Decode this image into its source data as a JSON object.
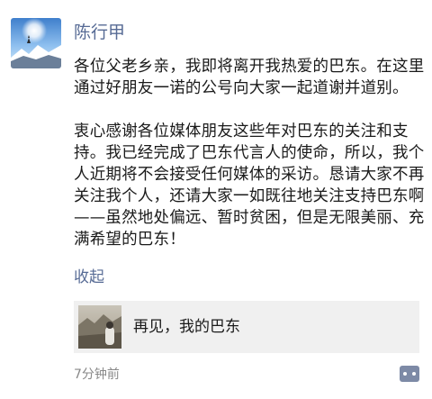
{
  "post": {
    "username": "陈行甲",
    "paragraphs": [
      "各位父老乡亲，我即将离开我热爱的巴东。在这里通过好朋友一诺的公号向大家一起道谢并道别。",
      "衷心感谢各位媒体朋友这些年对巴东的关注和支持。我已经完成了巴东代言人的使命，所以，我个人近期将不会接受任何媒体的采访。恳请大家不再关注我个人，还请大家一如既往地关注支持巴东啊——虽然地处偏远、暂时贫困，但是无限美丽、充满希望的巴东！"
    ],
    "collapse_label": "收起",
    "link_title": "再见，我的巴东",
    "time": "7分钟前"
  },
  "icons": {
    "comment": "comment-icon"
  },
  "colors": {
    "name_link": "#576b95",
    "card_bg": "#f0f0f0",
    "time": "#888888"
  }
}
